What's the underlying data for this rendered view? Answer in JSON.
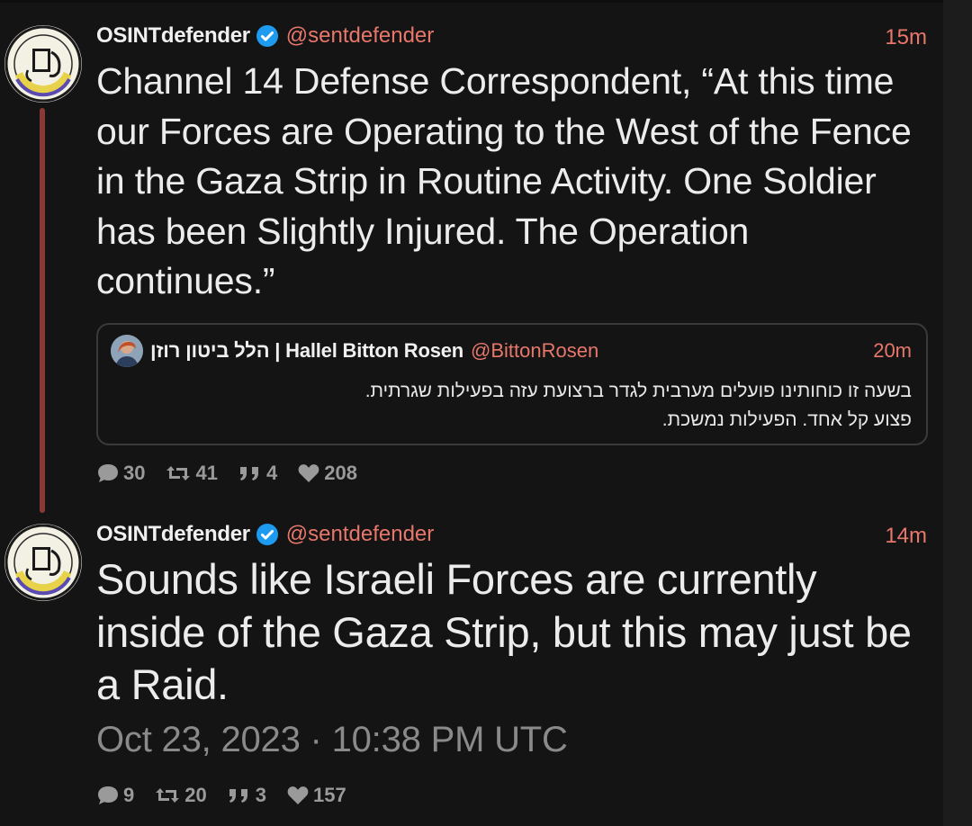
{
  "tweets": [
    {
      "author": {
        "display_name": "OSINTdefender",
        "handle": "@sentdefender",
        "avatar_icon": "osint-defender-logo"
      },
      "time": "15m",
      "text": "Channel 14 Defense Correspondent, “At this time our Forces are Operating to the West of the Fence in the Gaza Strip in Routine Activity. One Soldier has been Slightly Injured. The Operation continues.”",
      "quote": {
        "author": {
          "display_name": "הלל ביטון רוזן | Hallel Bitton Rosen",
          "handle": "@BittonRosen",
          "avatar_icon": "profile-photo"
        },
        "time": "20m",
        "text_line1": "בשעה זו כוחותינו פועלים מערבית לגדר ברצועת עזה בפעילות שגרתית.",
        "text_line2": "פצוע קל אחד. הפעילות נמשכת."
      },
      "stats": {
        "replies": "30",
        "retweets": "41",
        "quotes": "4",
        "likes": "208"
      }
    },
    {
      "author": {
        "display_name": "OSINTdefender",
        "handle": "@sentdefender",
        "avatar_icon": "osint-defender-logo"
      },
      "time": "14m",
      "text": "Sounds like Israeli Forces are currently inside of the Gaza Strip, but this may just be a Raid.",
      "date": "Oct 23, 2023 · 10:38 PM UTC",
      "stats": {
        "replies": "9",
        "retweets": "20",
        "quotes": "3",
        "likes": "157"
      }
    }
  ],
  "colors": {
    "background": "#141414",
    "accent": "#e8776b",
    "thread_line": "#8a3a36",
    "verified": "#1d9bf0",
    "muted": "#9a9a9a"
  }
}
